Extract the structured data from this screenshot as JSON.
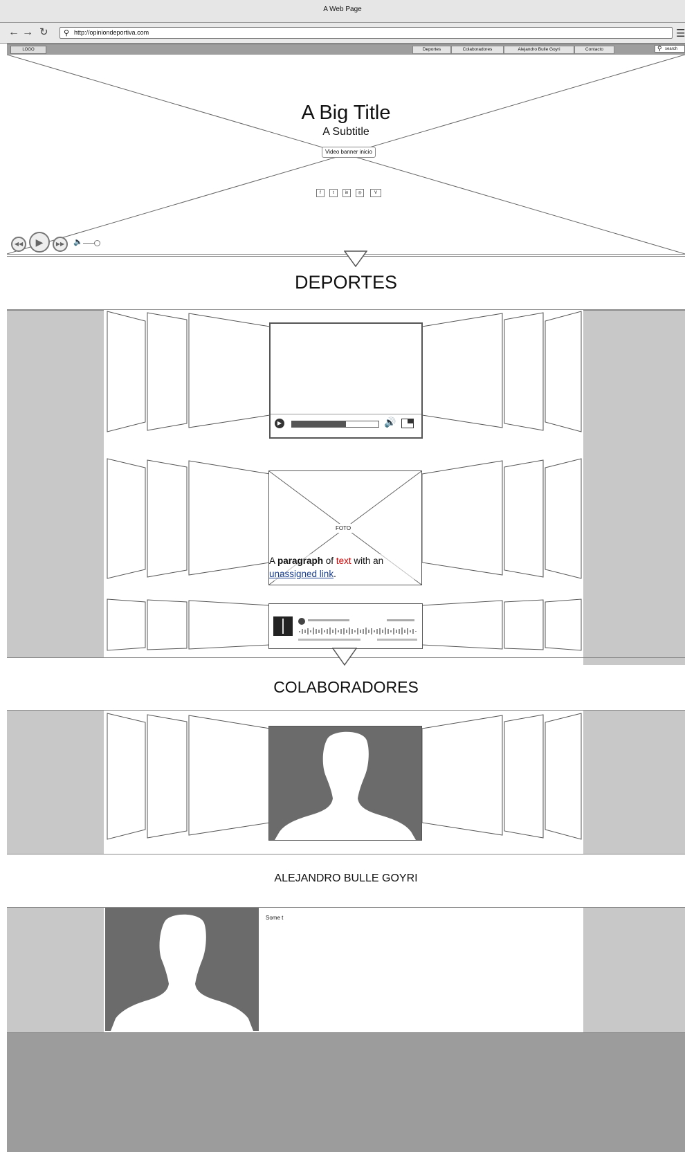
{
  "browser": {
    "window_title": "A Web Page",
    "url": "http://opiniondeportiva.com"
  },
  "nav": {
    "logo": "LOGO",
    "items": [
      {
        "label": "Deportes"
      },
      {
        "label": "Colaboradores"
      },
      {
        "label": "Alejandro Bulle Goyri"
      },
      {
        "label": "Contacto"
      }
    ],
    "search_placeholder": "search"
  },
  "hero": {
    "title": "A Big Title",
    "subtitle": "A Subtitle",
    "button_label": "Video banner inicio",
    "social_icons": [
      "facebook-icon",
      "twitter-icon",
      "linkedin-icon",
      "instagram-icon",
      "vimeo-icon"
    ],
    "social_glyphs": [
      "f",
      "t",
      "in",
      "◎",
      "V"
    ]
  },
  "deportes": {
    "heading": "DEPORTES",
    "photo_label": "FOTO",
    "paragraph": {
      "part1": "A ",
      "bold": "paragraph",
      "part2": " of ",
      "red": "text",
      "part3": " with an ",
      "link": "unassigned link",
      "part4": "."
    },
    "video_progress": 0.62
  },
  "colaboradores": {
    "heading": "COLABORADORES"
  },
  "profile": {
    "heading": "ALEJANDRO BULLE GOYRI",
    "text": "Some t"
  },
  "colors": {
    "red_text": "#cc0000",
    "link": "#1a3f8f",
    "panel_grey": "#c8c8c8",
    "footer_grey": "#9c9c9c",
    "photo_grey": "#6b6b6b"
  }
}
